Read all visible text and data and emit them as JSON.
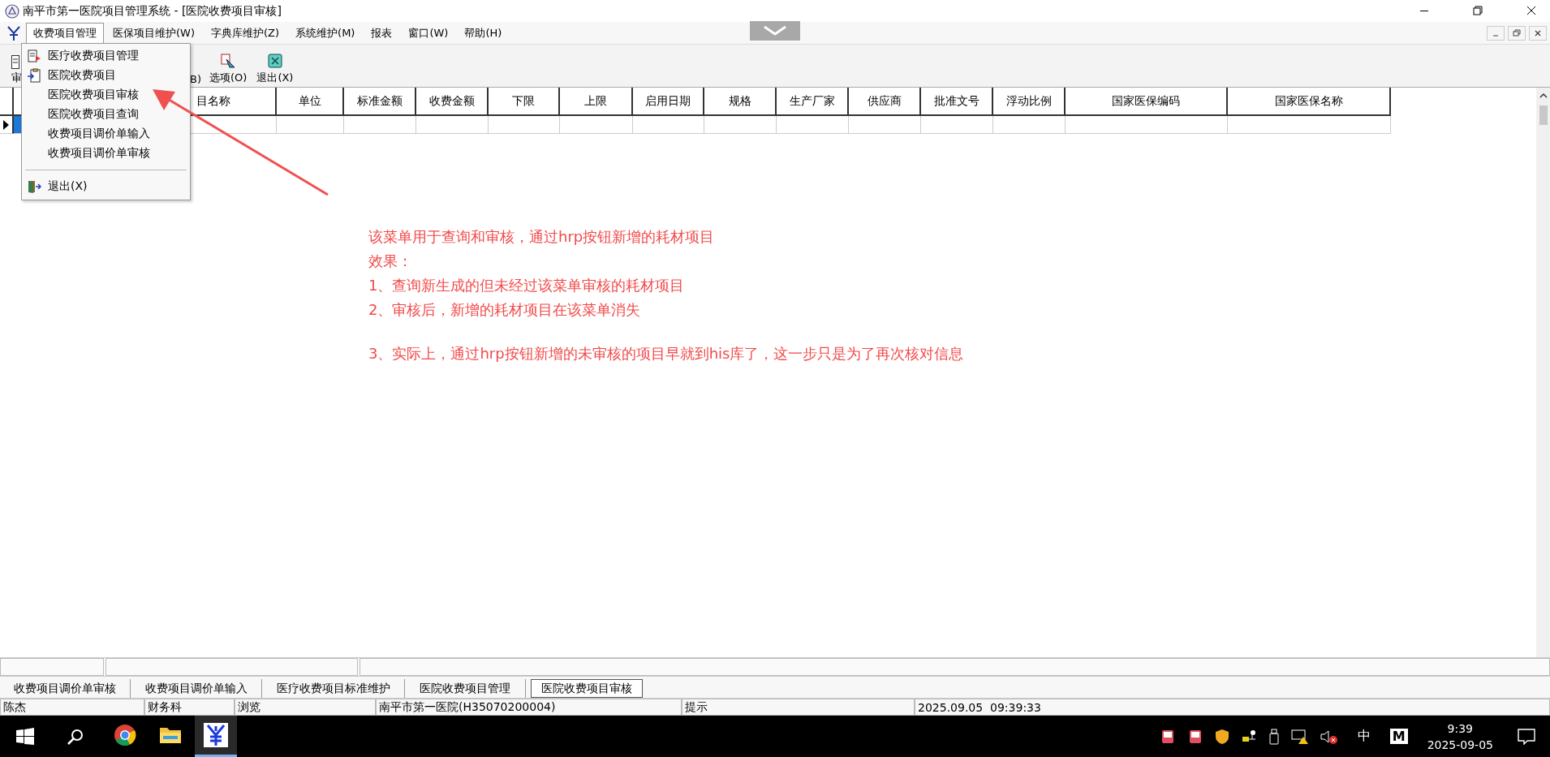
{
  "window": {
    "title": "南平市第一医院项目管理系统 - [医院收费项目审核]"
  },
  "menu_bar": [
    {
      "label": "收费项目管理",
      "selected": true
    },
    {
      "label": "医保项目维护(W)",
      "selected": false
    },
    {
      "label": "字典库维护(Z)",
      "selected": false
    },
    {
      "label": "系统维护(M)",
      "selected": false
    },
    {
      "label": "报表",
      "selected": false
    },
    {
      "label": "窗口(W)",
      "selected": false
    },
    {
      "label": "帮助(H)",
      "selected": false
    }
  ],
  "dropdown_menu": {
    "groups": [
      [
        {
          "label": "医疗收费项目管理",
          "kind": "doc"
        },
        {
          "label": "医院收费项目",
          "kind": "clipboard"
        },
        {
          "label": "医院收费项目审核",
          "kind": "plain"
        },
        {
          "label": "医院收费项目查询",
          "kind": "plain"
        },
        {
          "label": "收费项目调价单输入",
          "kind": "plain"
        },
        {
          "label": "收费项目调价单审核",
          "kind": "plain"
        }
      ],
      [
        {
          "label": "退出(X)",
          "kind": "exit"
        }
      ]
    ]
  },
  "toolbar": [
    {
      "label": "审",
      "kind": "doc"
    },
    {
      "label": "B)",
      "kind": "none"
    },
    {
      "label": "选项(O)",
      "kind": "options"
    },
    {
      "label": "退出(X)",
      "kind": "exit"
    }
  ],
  "table": {
    "columns": [
      "目名称",
      "单位",
      "标准金额",
      "收费金额",
      "下限",
      "上限",
      "启用日期",
      "规格",
      "生产厂家",
      "供应商",
      "批准文号",
      "浮动比例",
      "国家医保编码",
      "国家医保名称"
    ]
  },
  "annotation": {
    "paragraphs": [
      [
        "该菜单用于查询和审核，通过hrp按钮新增的耗材项目",
        "效果：",
        "1、查询新生成的但未经过该菜单审核的耗材项目",
        "2、审核后，新增的耗材项目在该菜单消失"
      ],
      [
        "3、实际上，通过hrp按钮新增的未审核的项目早就到his库了，这一步只是为了再次核对信息"
      ]
    ]
  },
  "tabs": [
    {
      "label": "收费项目调价单审核",
      "selected": false
    },
    {
      "label": "收费项目调价单输入",
      "selected": false
    },
    {
      "label": "医疗收费项目标准维护",
      "selected": false
    },
    {
      "label": "医院收费项目管理",
      "selected": false
    },
    {
      "label": "医院收费项目审核",
      "selected": true
    }
  ],
  "status_bar": [
    "陈杰",
    "财务科",
    "浏览",
    "南平市第一医院(H35070200004)",
    "提示",
    "2025.09.05  09:39:33"
  ],
  "taskbar": {
    "apps": [
      {
        "kind": "chrome",
        "selected": false
      },
      {
        "kind": "folder",
        "selected": false
      },
      {
        "kind": "app",
        "selected": true
      }
    ],
    "tray": {
      "ime": "中",
      "ime_mode": "M",
      "time": "9:39",
      "date": "2025-09-05"
    }
  }
}
